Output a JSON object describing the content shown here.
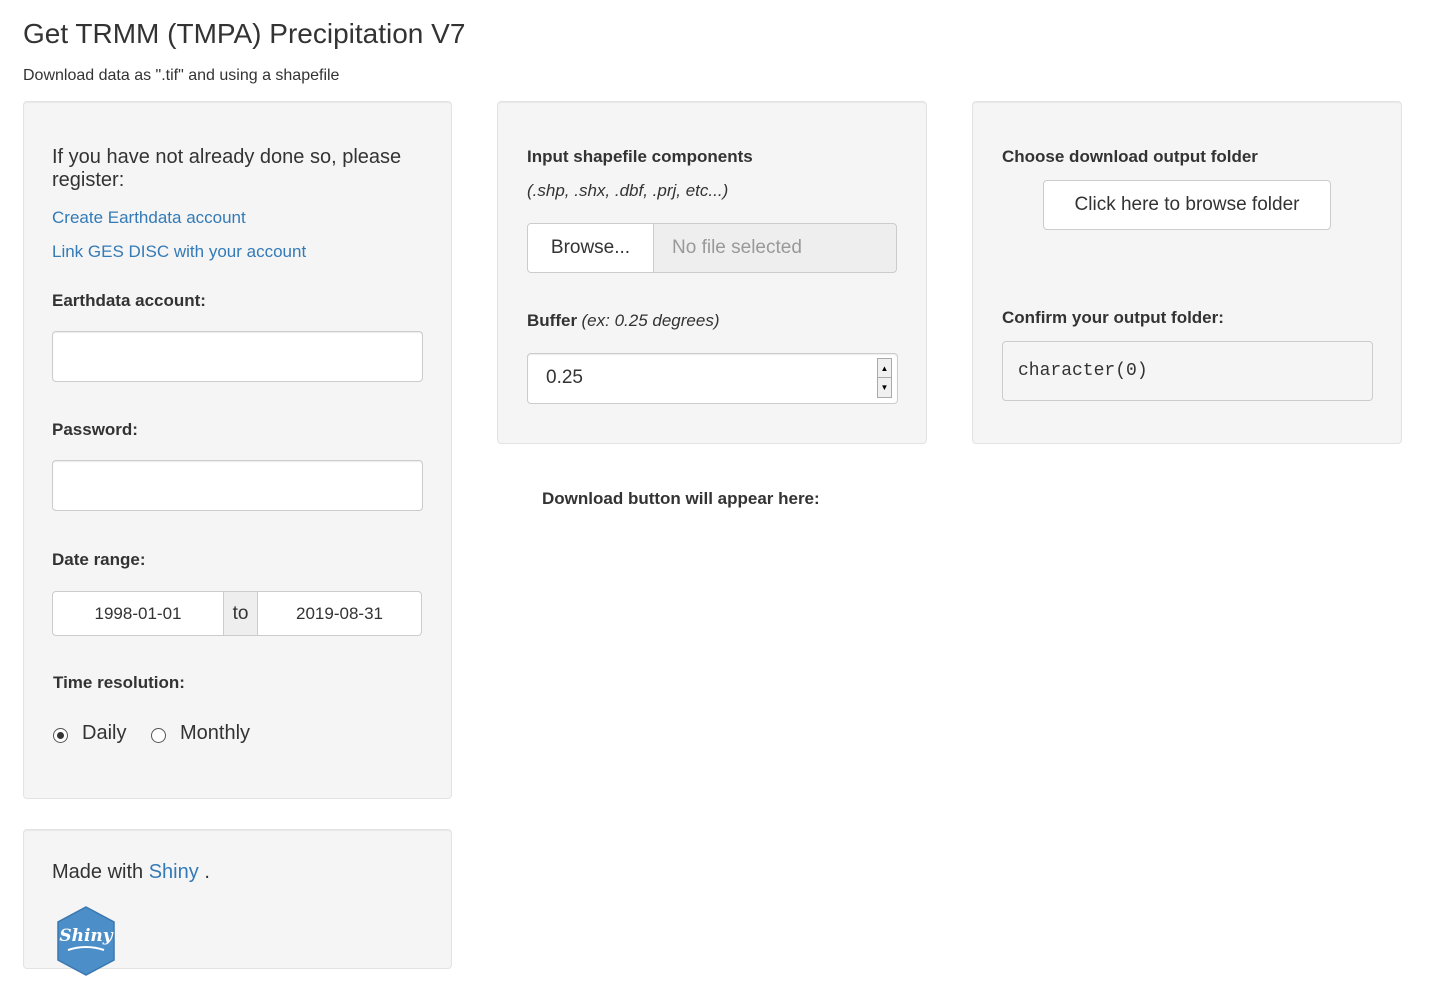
{
  "header": {
    "title": "Get TRMM (TMPA) Precipitation V7",
    "subtitle": "Download data as \".tif\" and using a shapefile"
  },
  "left_panel": {
    "register_text": "If you have not already done so, please register:",
    "link_earthdata": "Create Earthdata account",
    "link_gesdisc": "Link GES DISC with your account",
    "account_label": "Earthdata account:",
    "account_value": "",
    "password_label": "Password:",
    "password_value": "",
    "date_range_label": "Date range:",
    "date_start": "1998-01-01",
    "date_sep": "to",
    "date_end": "2019-08-31",
    "time_resolution_label": "Time resolution:",
    "options": [
      {
        "label": "Daily",
        "selected": true
      },
      {
        "label": "Monthly",
        "selected": false
      }
    ]
  },
  "middle_panel": {
    "shapefile_label": "Input shapefile components",
    "shapefile_hint": "(.shp, .shx, .dbf, .prj, etc...)",
    "browse_button": "Browse...",
    "no_file_text": "No file selected",
    "buffer_label": "Buffer",
    "buffer_hint": "(ex: 0.25 degrees)",
    "buffer_value": "0.25",
    "download_note": "Download button will appear here:"
  },
  "right_panel": {
    "choose_label": "Choose download output folder",
    "browse_folder_button": "Click here to browse folder",
    "confirm_label": "Confirm your output folder:",
    "confirm_value": "character(0)"
  },
  "footer": {
    "made_with": "Made with",
    "shiny_link": "Shiny",
    "period": ".",
    "logo_text": "Shiny"
  },
  "colors": {
    "link": "#337ab7",
    "well_bg": "#f5f5f5",
    "logo_blue": "#4c8fc8"
  }
}
